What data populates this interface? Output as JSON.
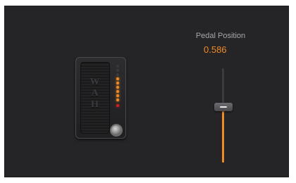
{
  "parameter": {
    "label": "Pedal Position",
    "value_text": "0.586",
    "value": 0.586
  },
  "pedal": {
    "wordmark": "WAH",
    "led_total": 9,
    "led_lit": 6
  },
  "colors": {
    "background": "#252527",
    "accent": "#f08a24",
    "label": "#a7a7ab",
    "track": "#3b3b3e"
  },
  "icons": {
    "footswitch": "footswitch-icon"
  }
}
